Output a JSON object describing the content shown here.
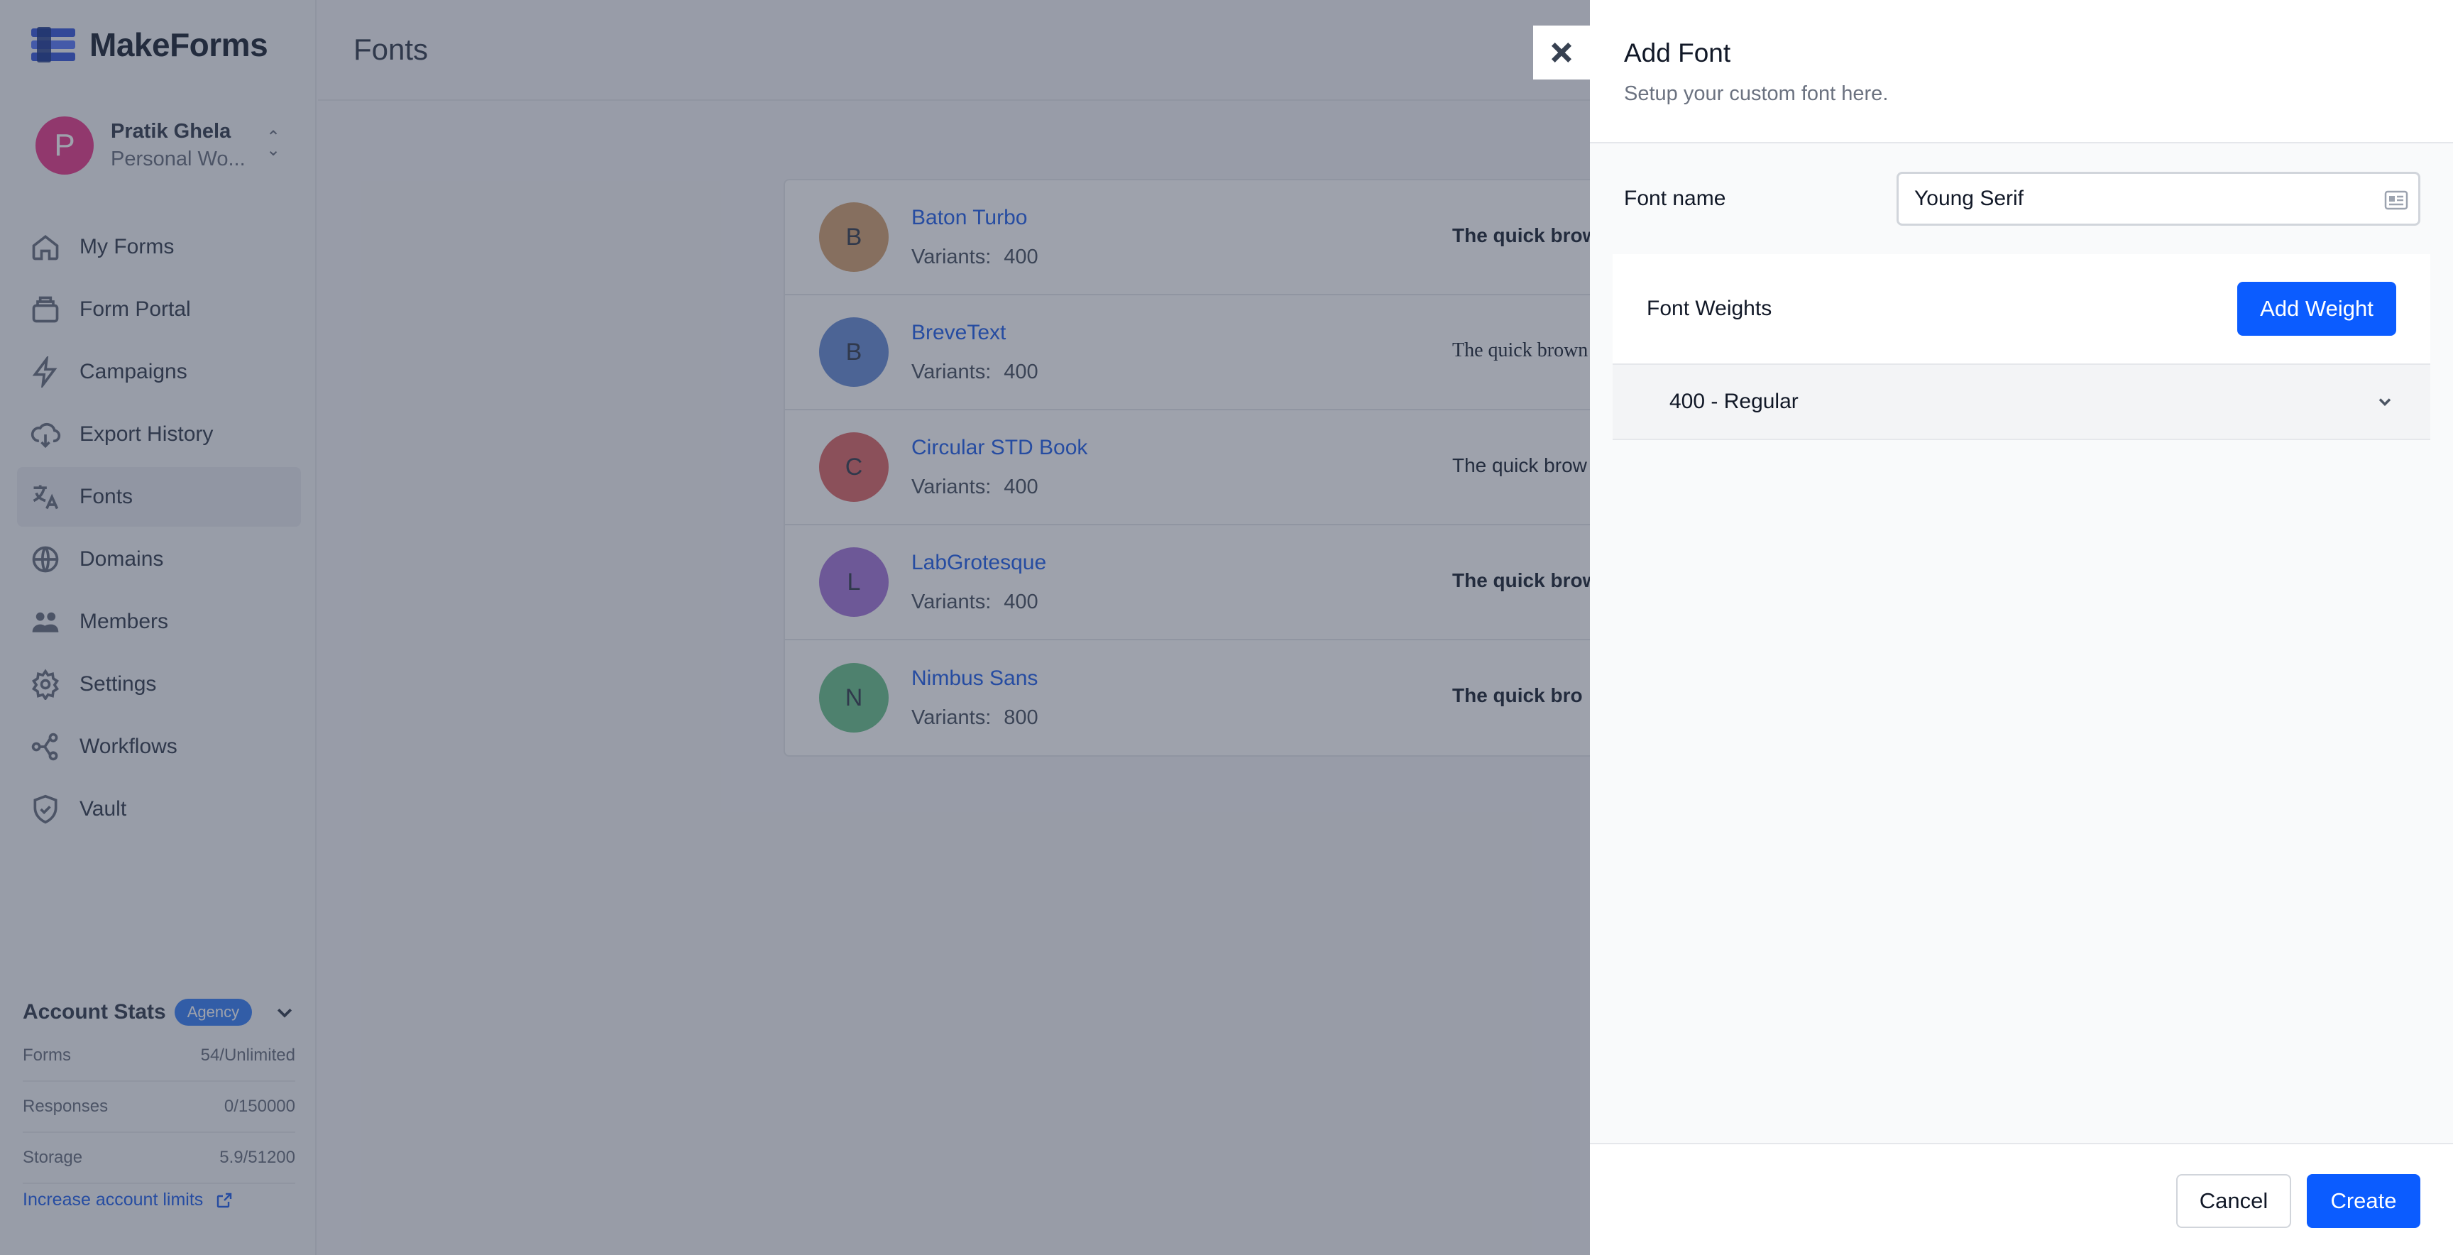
{
  "app": {
    "name": "MakeForms"
  },
  "user": {
    "initial": "P",
    "name": "Pratik Ghela",
    "workspace": "Personal Wo..."
  },
  "sidebar": {
    "items": [
      {
        "label": "My Forms",
        "icon": "home-icon"
      },
      {
        "label": "Form Portal",
        "icon": "portal-icon"
      },
      {
        "label": "Campaigns",
        "icon": "lightning-icon"
      },
      {
        "label": "Export History",
        "icon": "cloud-download-icon"
      },
      {
        "label": "Fonts",
        "icon": "translate-icon",
        "active": true
      },
      {
        "label": "Domains",
        "icon": "globe-icon"
      },
      {
        "label": "Members",
        "icon": "users-icon"
      },
      {
        "label": "Settings",
        "icon": "gear-icon"
      },
      {
        "label": "Workflows",
        "icon": "workflow-icon"
      },
      {
        "label": "Vault",
        "icon": "shield-icon"
      }
    ]
  },
  "account_stats": {
    "title": "Account Stats",
    "badge": "Agency",
    "rows": [
      {
        "label": "Forms",
        "value": "54/Unlimited"
      },
      {
        "label": "Responses",
        "value": "0/150000"
      },
      {
        "label": "Storage",
        "value": "5.9/51200"
      }
    ],
    "link": "Increase account limits"
  },
  "page": {
    "title": "Fonts"
  },
  "fonts": [
    {
      "initial": "B",
      "name": "Baton Turbo",
      "variants_label": "Variants:",
      "variants": "400",
      "sample": "The quick brow",
      "color": "#d4a373",
      "bold": true,
      "serif": false
    },
    {
      "initial": "B",
      "name": "BreveText",
      "variants_label": "Variants:",
      "variants": "400",
      "sample": "The quick brown",
      "color": "#6b8fd6",
      "bold": false,
      "serif": true
    },
    {
      "initial": "C",
      "name": "Circular STD Book",
      "variants_label": "Variants:",
      "variants": "400",
      "sample": "The quick brow",
      "color": "#dc6b6b",
      "bold": false,
      "serif": false
    },
    {
      "initial": "L",
      "name": "LabGrotesque",
      "variants_label": "Variants:",
      "variants": "400",
      "sample": "The quick brow",
      "color": "#a779d9",
      "bold": true,
      "serif": false
    },
    {
      "initial": "N",
      "name": "Nimbus Sans",
      "variants_label": "Variants:",
      "variants": "800",
      "sample": "The quick bro",
      "color": "#6ec48e",
      "bold": true,
      "serif": false
    }
  ],
  "drawer": {
    "title": "Add Font",
    "subtitle": "Setup your custom font here.",
    "font_name_label": "Font name",
    "font_name_value": "Young Serif",
    "weights_title": "Font Weights",
    "add_weight_label": "Add Weight",
    "weights": [
      "400 - Regular"
    ],
    "cancel_label": "Cancel",
    "create_label": "Create"
  },
  "colors": {
    "primary": "#0b5cff",
    "link": "#2563eb",
    "badge": "#3b82f6"
  }
}
